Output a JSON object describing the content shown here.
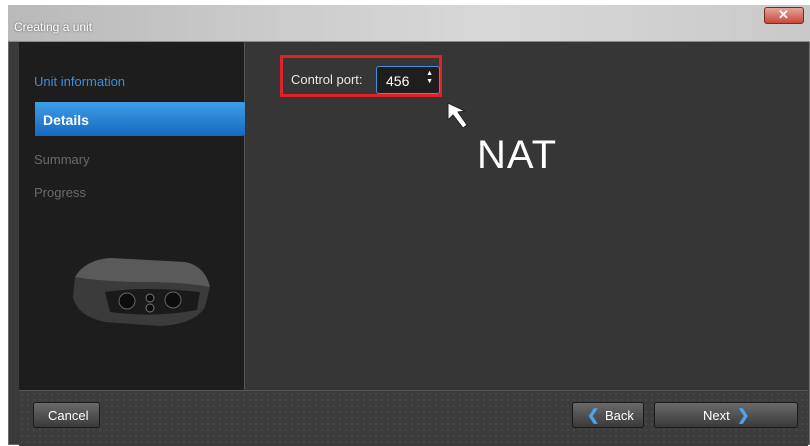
{
  "window": {
    "title": "Creating a unit",
    "close_glyph": "✕"
  },
  "sidebar": {
    "items": [
      {
        "label": "Unit information",
        "state": "visited"
      },
      {
        "label": "Details",
        "state": "active"
      },
      {
        "label": "Summary",
        "state": "disabled"
      },
      {
        "label": "Progress",
        "state": "disabled"
      }
    ]
  },
  "main": {
    "control_port_label": "Control port:",
    "control_port_value": "456",
    "annotation": "NAT"
  },
  "footer": {
    "cancel_label": "Cancel",
    "back_label": "Back",
    "next_label": "Next"
  },
  "colors": {
    "accent": "#1c7ad6",
    "highlight_border": "#e0202a",
    "link": "#3a8fd8"
  },
  "icons": [
    "close-icon",
    "spin-arrows-icon",
    "cursor-arrow-icon",
    "chevron-left-icon",
    "chevron-right-icon",
    "camera-device-icon"
  ]
}
